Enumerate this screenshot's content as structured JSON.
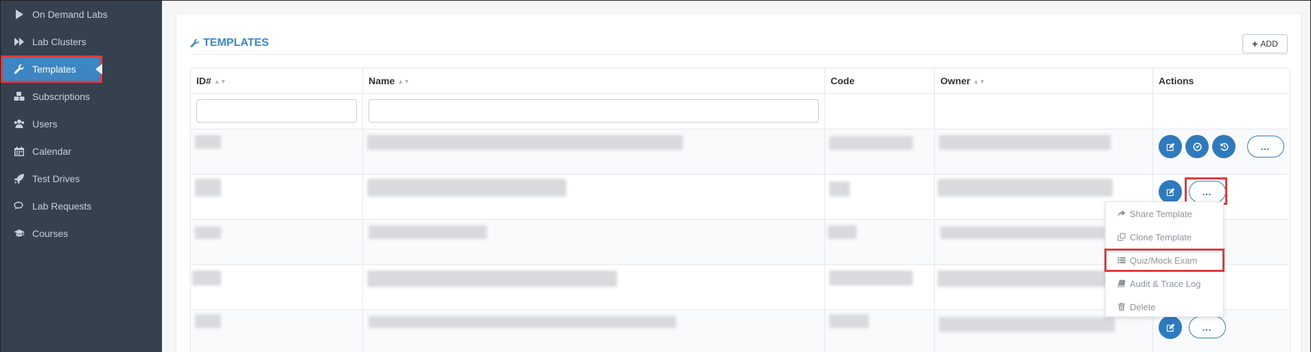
{
  "sidebar": {
    "items": [
      {
        "label": "On Demand Labs",
        "icon": "play-icon"
      },
      {
        "label": "Lab Clusters",
        "icon": "fast-forward-icon"
      },
      {
        "label": "Templates",
        "icon": "wrench-icon",
        "active": true
      },
      {
        "label": "Subscriptions",
        "icon": "cubes-icon"
      },
      {
        "label": "Users",
        "icon": "users-icon"
      },
      {
        "label": "Calendar",
        "icon": "calendar-icon"
      },
      {
        "label": "Test Drives",
        "icon": "rocket-icon"
      },
      {
        "label": "Lab Requests",
        "icon": "comments-icon"
      },
      {
        "label": "Courses",
        "icon": "graduation-cap-icon"
      }
    ]
  },
  "page": {
    "title": "TEMPLATES",
    "add_label": "ADD"
  },
  "table": {
    "columns": [
      "ID#",
      "Name",
      "Code",
      "Owner",
      "Actions"
    ],
    "rows": [
      {
        "id": "",
        "name": "",
        "code": "",
        "owner": "",
        "actions": [
          "edit",
          "check",
          "history",
          "more"
        ]
      },
      {
        "id": "",
        "name": "",
        "code": "",
        "owner": "",
        "actions": [
          "edit",
          "more"
        ]
      },
      {
        "id": "",
        "name": "",
        "code": "",
        "owner": "",
        "actions": []
      },
      {
        "id": "",
        "name": "",
        "code": "",
        "owner": "",
        "actions": []
      },
      {
        "id": "",
        "name": "",
        "code": "",
        "owner": "",
        "actions": [
          "edit",
          "more"
        ]
      }
    ]
  },
  "dropdown": {
    "items": [
      {
        "label": "Share Template",
        "icon": "share-icon"
      },
      {
        "label": "Clone Template",
        "icon": "clone-icon"
      },
      {
        "label": "Quiz/Mock Exam",
        "icon": "list-icon"
      },
      {
        "label": "Audit & Trace Log",
        "icon": "book-icon"
      },
      {
        "label": "Delete",
        "icon": "trash-icon"
      }
    ]
  },
  "colors": {
    "sidebar_bg": "#364150",
    "accent": "#3c86c4",
    "highlight": "#e0393e"
  }
}
